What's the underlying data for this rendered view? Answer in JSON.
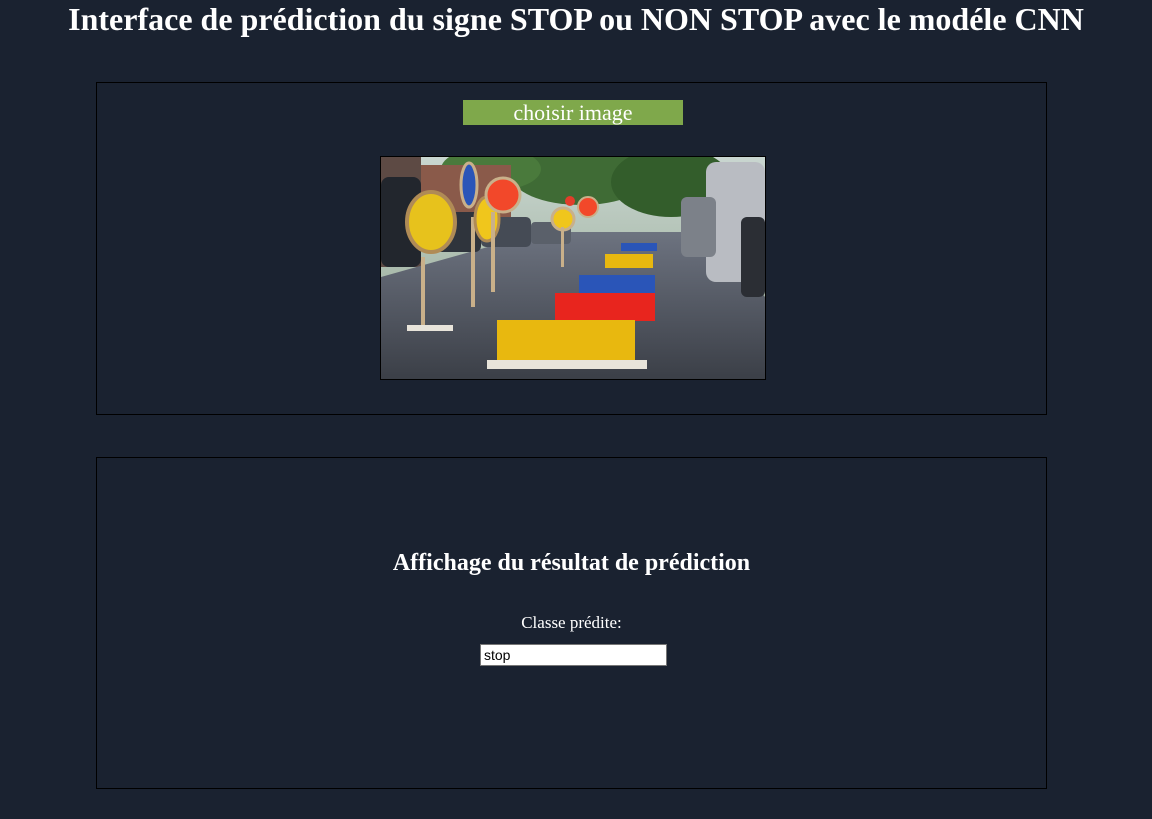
{
  "header": {
    "title": "Interface de prédiction du signe STOP ou NON STOP avec le modéle CNN"
  },
  "upload": {
    "button_label": "choisir image",
    "image_icon": "street-photo-image"
  },
  "result": {
    "heading": "Affichage du résultat de prédiction",
    "class_label": "Classe prédite:",
    "class_value": "stop"
  },
  "colors": {
    "background": "#1a2230",
    "button": "#7fa84b",
    "text": "#ffffff"
  }
}
